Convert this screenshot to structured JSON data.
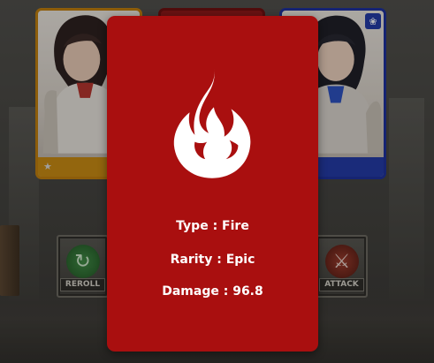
{
  "characters": [
    {
      "position": "left",
      "frame_color": "#c07d0a",
      "bar_color": "#c88a10"
    },
    {
      "position": "middle",
      "frame_color": "#6b0d0d"
    },
    {
      "position": "right",
      "frame_color": "#1b2f9a",
      "bar_color": "#2138a6"
    }
  ],
  "buttons": {
    "reroll": {
      "label": "REROLL",
      "icon": "reroll-icon"
    },
    "attack": {
      "label": "ATTACK",
      "icon": "crossed-swords-icon"
    }
  },
  "detail": {
    "background_color": "#a90f0f",
    "icon": "fire-icon",
    "type_line": "Type : Fire",
    "rarity_line": "Rarity : Epic",
    "damage_line": "Damage : 96.8"
  },
  "icons": {
    "star": "★",
    "paw": "❀"
  }
}
